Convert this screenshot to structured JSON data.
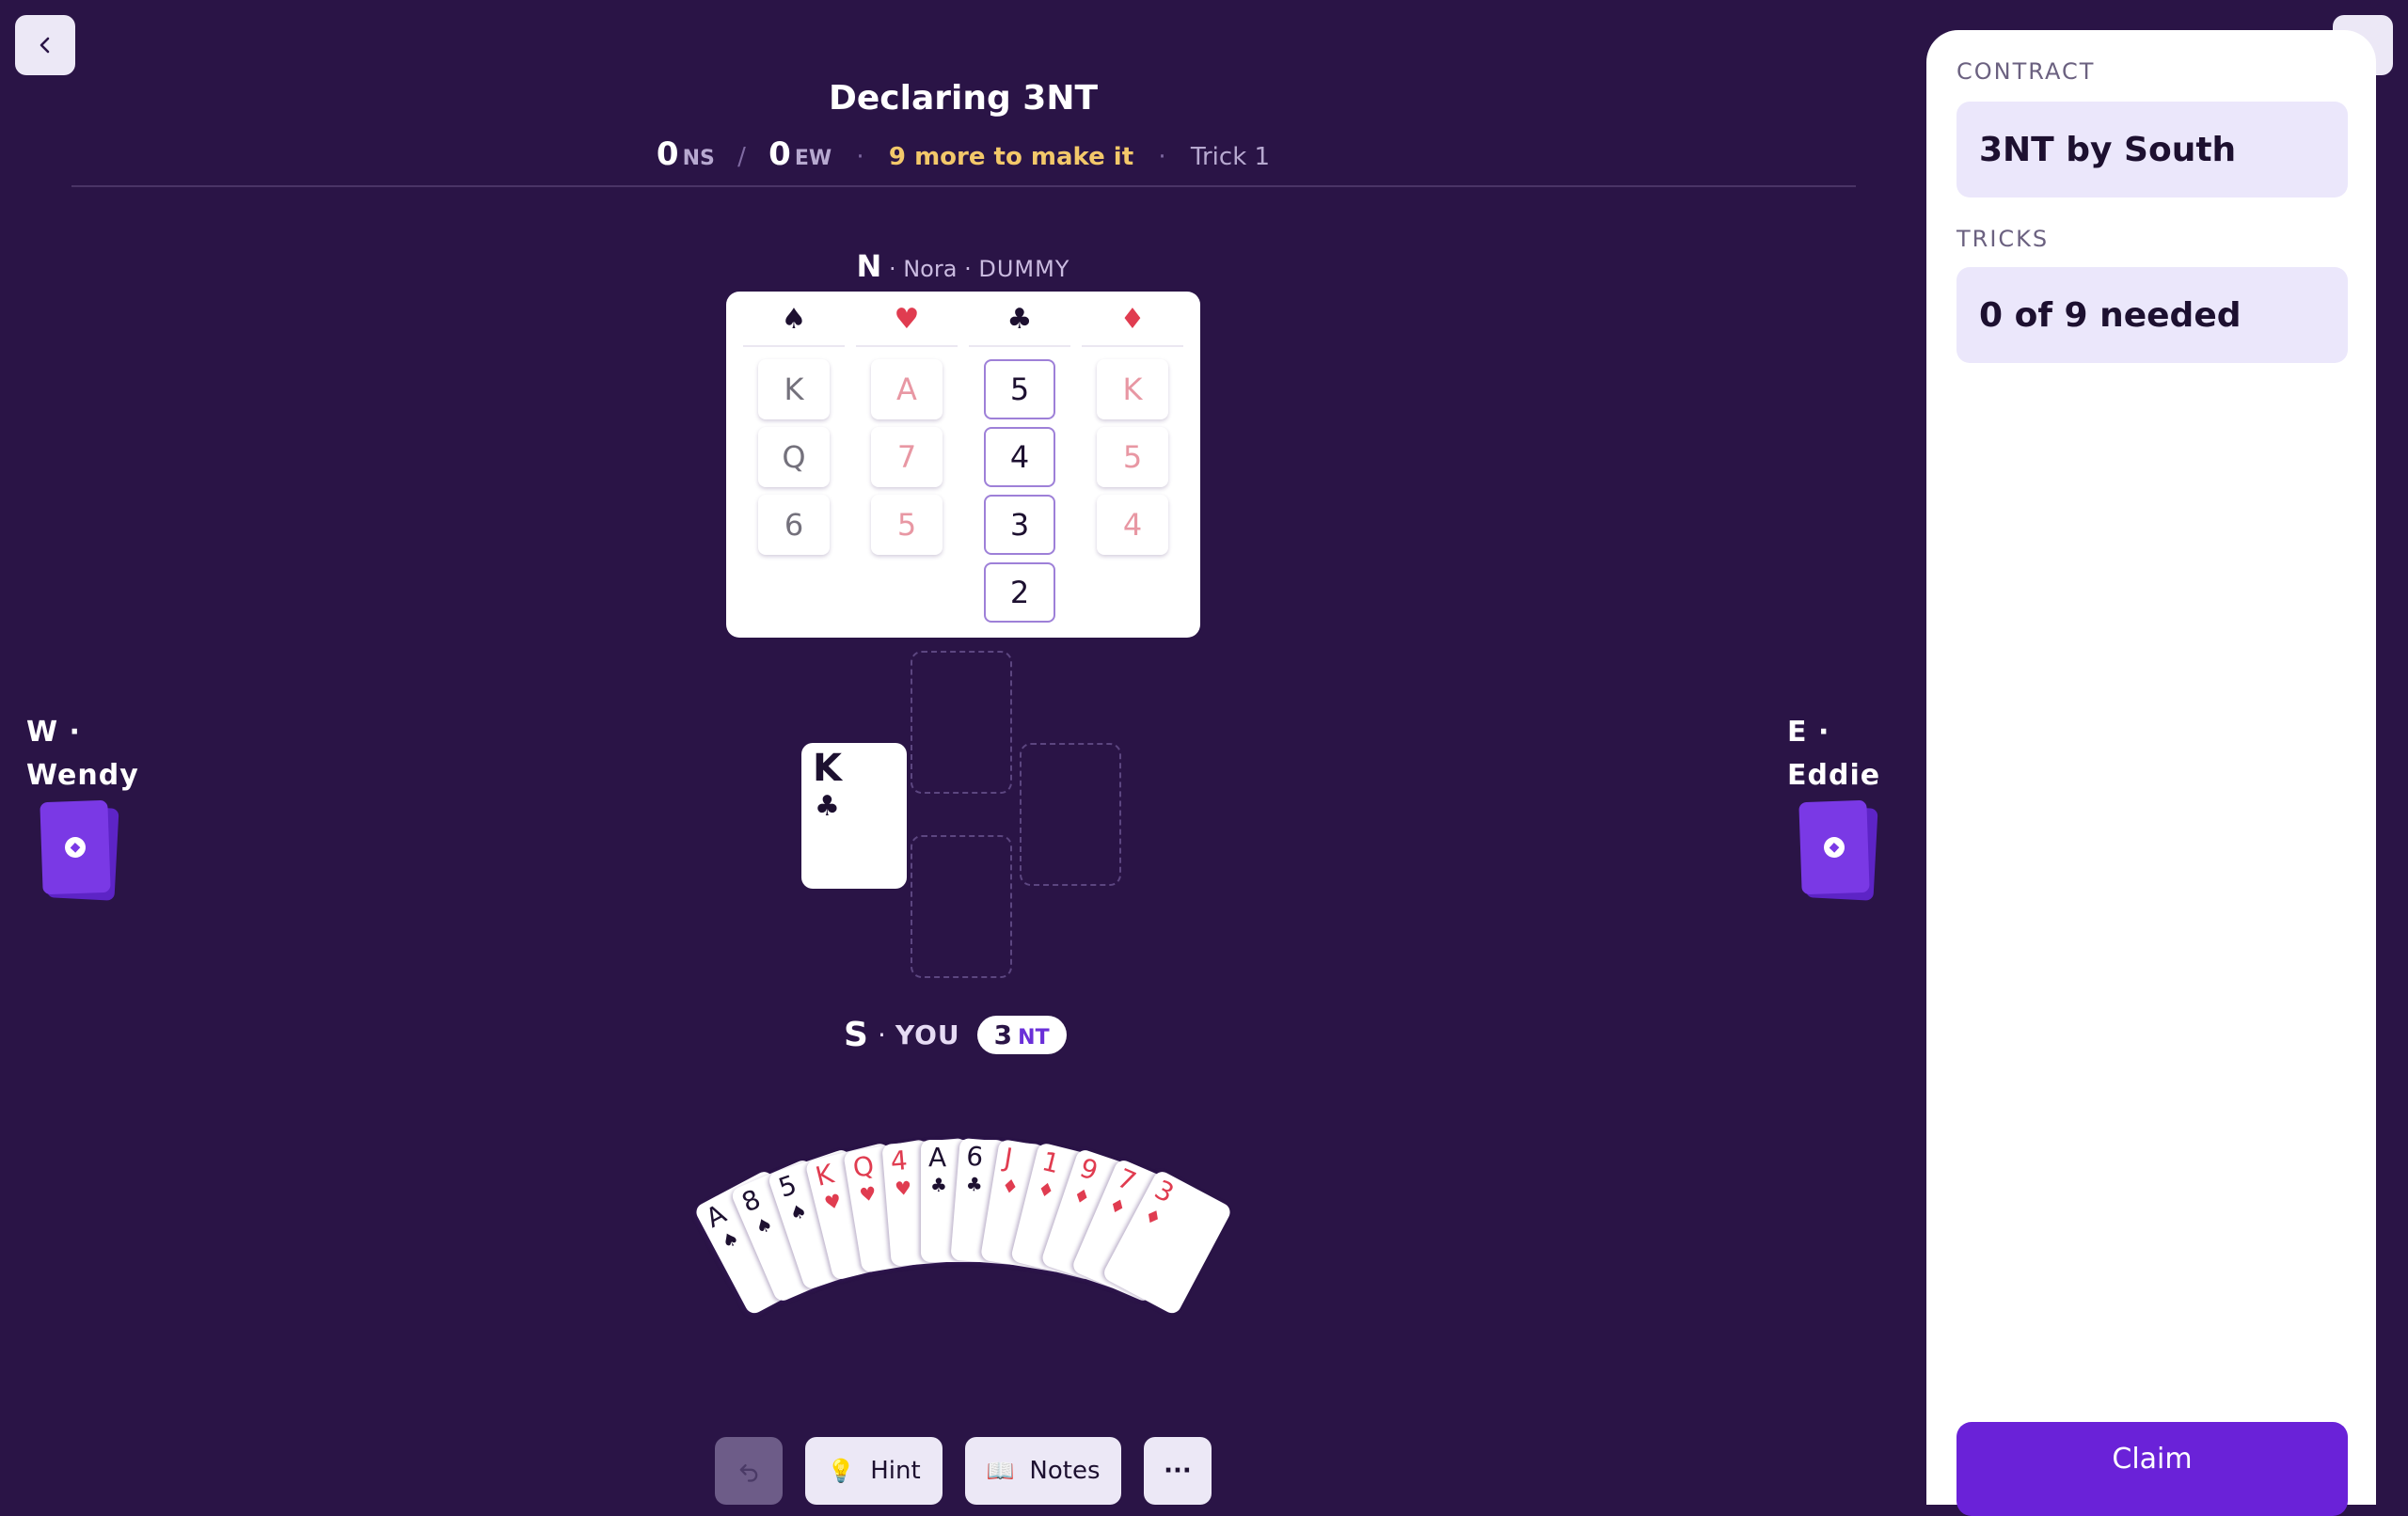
{
  "nav": {
    "back_icon": "chevron-left-icon",
    "forward_icon": "chevron-right-icon"
  },
  "header": {
    "title": "Declaring 3NT",
    "ns_score": "0",
    "ns_label": "NS",
    "ew_score": "0",
    "ew_label": "EW",
    "separator": "/",
    "to_make": "9 more to make it",
    "trick": "Trick 1"
  },
  "north": {
    "seat": "N",
    "name": "Nora",
    "role": "DUMMY",
    "suits": [
      {
        "symbol": "♠",
        "color": "#1d1030",
        "cards": [
          "K",
          "Q",
          "6"
        ],
        "playable": false
      },
      {
        "symbol": "♥",
        "color": "#e03c50",
        "cards": [
          "A",
          "7",
          "5"
        ],
        "playable": false
      },
      {
        "symbol": "♣",
        "color": "#1d1030",
        "cards": [
          "5",
          "4",
          "3",
          "2"
        ],
        "playable": true
      },
      {
        "symbol": "♦",
        "color": "#e03c50",
        "cards": [
          "K",
          "5",
          "4"
        ],
        "playable": false
      }
    ]
  },
  "west": {
    "seat": "W",
    "name": "Wendy"
  },
  "east": {
    "seat": "E",
    "name": "Eddie"
  },
  "trick": {
    "west_card": {
      "rank": "K",
      "suit": "♣"
    }
  },
  "south": {
    "seat": "S",
    "name": "YOU",
    "contract_level": "3",
    "contract_strain": "NT",
    "hand": [
      {
        "rank": "A",
        "suit": "♠",
        "color": "black"
      },
      {
        "rank": "8",
        "suit": "♠",
        "color": "black"
      },
      {
        "rank": "5",
        "suit": "♠",
        "color": "black"
      },
      {
        "rank": "K",
        "suit": "♥",
        "color": "red"
      },
      {
        "rank": "Q",
        "suit": "♥",
        "color": "red"
      },
      {
        "rank": "4",
        "suit": "♥",
        "color": "red"
      },
      {
        "rank": "A",
        "suit": "♣",
        "color": "black"
      },
      {
        "rank": "6",
        "suit": "♣",
        "color": "black"
      },
      {
        "rank": "J",
        "suit": "♦",
        "color": "red"
      },
      {
        "rank": "1",
        "suit": "♦",
        "color": "red"
      },
      {
        "rank": "9",
        "suit": "♦",
        "color": "red"
      },
      {
        "rank": "7",
        "suit": "♦",
        "color": "red"
      },
      {
        "rank": "3",
        "suit": "♦",
        "color": "red"
      }
    ]
  },
  "toolbar": {
    "undo_icon": "undo-icon",
    "hint_label": "Hint",
    "hint_icon": "💡",
    "notes_label": "Notes",
    "notes_icon": "📖",
    "more_label": "···"
  },
  "panel": {
    "contract_heading": "CONTRACT",
    "contract_value": "3NT by South",
    "tricks_heading": "TRICKS",
    "tricks_value": "0 of 9 needed",
    "claim_label": "Claim"
  },
  "colors": {
    "background": "#2a1446",
    "accent": "#6a22d8",
    "score_highlight": "#f3c86a",
    "red_suit": "#e03c50"
  }
}
